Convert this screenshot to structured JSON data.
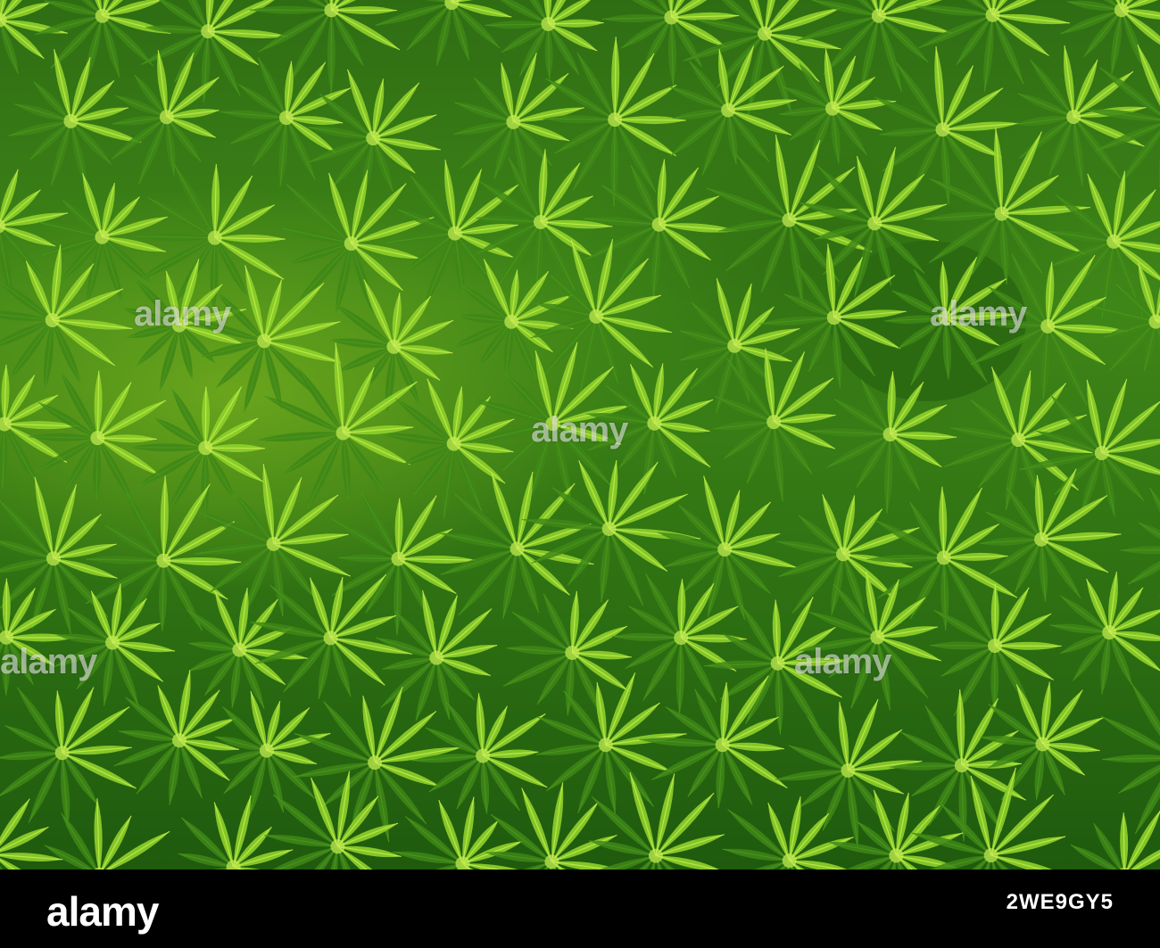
{
  "photo": {
    "subject": "palm-canopy",
    "colors": {
      "deep": "#1f5a0e",
      "mid": "#3f8618",
      "light": "#8fd12a",
      "highlight": "#c8f052"
    }
  },
  "watermarks": {
    "a": "alamy",
    "b": "alamy",
    "c": "alamy",
    "d": "alamy",
    "e": "alamy"
  },
  "footer": {
    "brand": "alamy",
    "image_id": "2WE9GY5"
  }
}
